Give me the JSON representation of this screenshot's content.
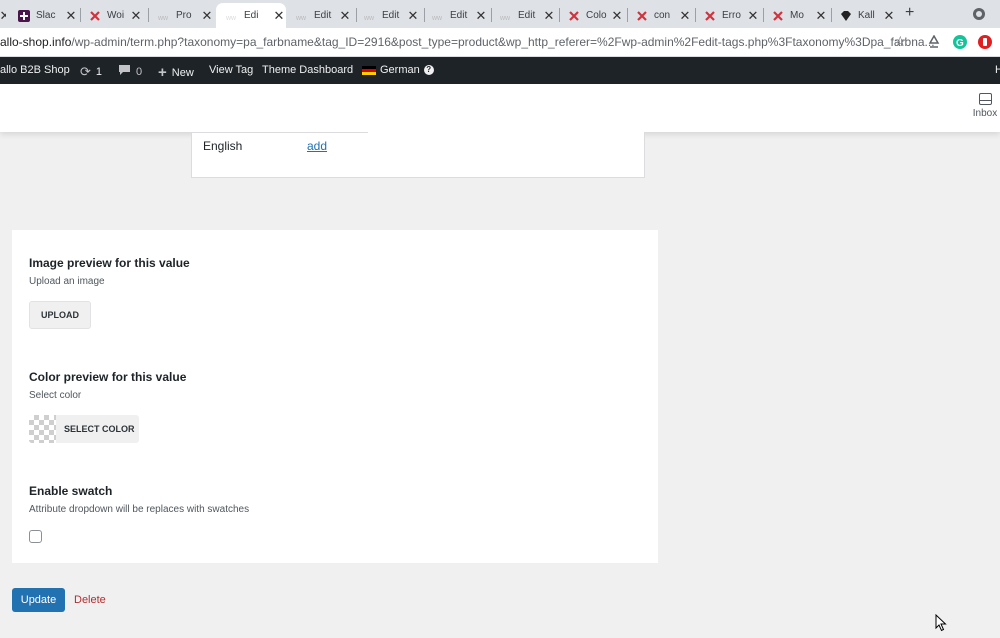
{
  "browser": {
    "tabs": [
      {
        "title": "Slac",
        "icon": "slack-icon",
        "active": false
      },
      {
        "title": "Woi",
        "icon": "joomla-icon",
        "active": false
      },
      {
        "title": "Pro",
        "icon": "wordpress-icon",
        "active": false
      },
      {
        "title": "Edi",
        "icon": "wordpress-icon",
        "active": true
      },
      {
        "title": "Edit",
        "icon": "wordpress-icon",
        "active": false
      },
      {
        "title": "Edit",
        "icon": "wordpress-icon",
        "active": false
      },
      {
        "title": "Edit",
        "icon": "wordpress-icon",
        "active": false
      },
      {
        "title": "Edit",
        "icon": "wordpress-icon",
        "active": false
      },
      {
        "title": "Colo",
        "icon": "joomla-icon",
        "active": false
      },
      {
        "title": "con",
        "icon": "joomla-icon",
        "active": false
      },
      {
        "title": "Erro",
        "icon": "joomla-icon",
        "active": false
      },
      {
        "title": "Mo",
        "icon": "joomla-icon",
        "active": false
      },
      {
        "title": "Kall",
        "icon": "diamond-icon",
        "active": false
      }
    ],
    "close_glyph": "✕",
    "newtab_glyph": "+",
    "url_host": "allo-shop.info",
    "url_path": "/wp-admin/term.php?taxonomy=pa_farbname&tag_ID=2916&post_type=product&wp_http_referer=%2Fwp-admin%2Fedit-tags.php%3Ftaxonomy%3Dpa_farbna..."
  },
  "adminbar": {
    "site_name": "allo B2B Shop",
    "updates_count": "1",
    "comments_count": "0",
    "new_label": "New",
    "view_tag_label": "View Tag",
    "theme_dashboard_label": "Theme Dashboard",
    "language_label": "German",
    "right_initial": "H"
  },
  "header": {
    "inbox_label": "Inbox"
  },
  "translations": {
    "language": "English",
    "add_label": "add"
  },
  "swatch": {
    "image_title": "Image preview for this value",
    "image_desc": "Upload an image",
    "upload_label": "UPLOAD",
    "color_title": "Color preview for this value",
    "color_desc": "Select color",
    "select_color_label": "SELECT COLOR",
    "enable_title": "Enable swatch",
    "enable_desc": "Attribute dropdown will be replaces with swatches",
    "enable_checked": false
  },
  "actions": {
    "update_label": "Update",
    "delete_label": "Delete"
  },
  "colors": {
    "admin_bar": "#1d2327",
    "primary": "#2271b1",
    "danger": "#b32d2e",
    "page_bg": "#f0f0f1"
  }
}
